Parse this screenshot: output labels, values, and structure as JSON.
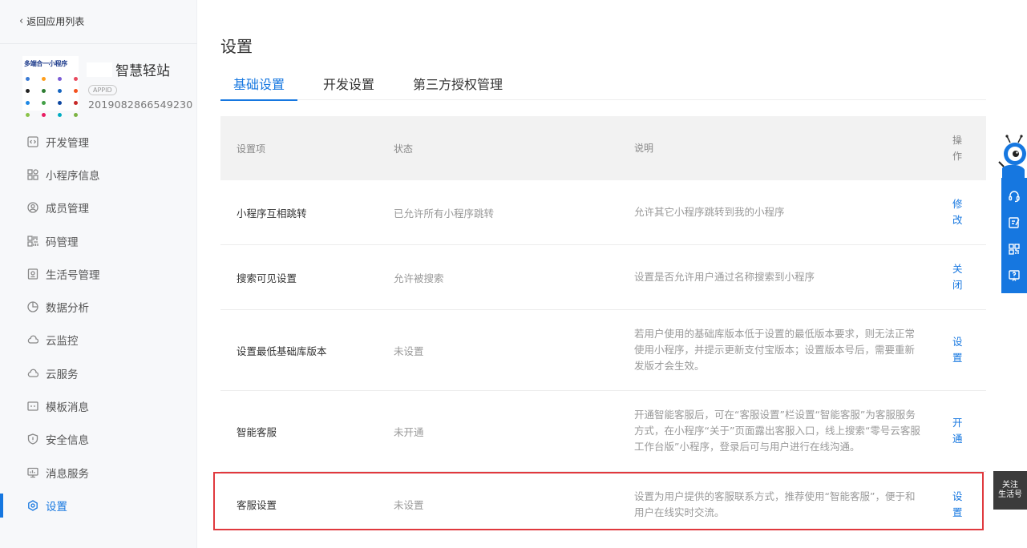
{
  "sidebar": {
    "back_label": "返回应用列表",
    "app": {
      "logo_text": "多端合一小程序",
      "name": "智慧轻站",
      "appid_badge": "APPID",
      "appid": "2019082866549230"
    },
    "items": [
      {
        "label": "开发管理",
        "icon": "code-icon"
      },
      {
        "label": "小程序信息",
        "icon": "grid-icon"
      },
      {
        "label": "成员管理",
        "icon": "user-icon"
      },
      {
        "label": "码管理",
        "icon": "qrcode-icon"
      },
      {
        "label": "生活号管理",
        "icon": "life-account-icon"
      },
      {
        "label": "数据分析",
        "icon": "pie-chart-icon"
      },
      {
        "label": "云监控",
        "icon": "cloud-icon"
      },
      {
        "label": "云服务",
        "icon": "cloud-icon"
      },
      {
        "label": "模板消息",
        "icon": "message-template-icon"
      },
      {
        "label": "安全信息",
        "icon": "shield-icon"
      },
      {
        "label": "消息服务",
        "icon": "monitor-icon"
      },
      {
        "label": "设置",
        "icon": "gear-icon",
        "active": true
      }
    ]
  },
  "main": {
    "title": "设置",
    "tabs": [
      {
        "label": "基础设置",
        "active": true
      },
      {
        "label": "开发设置"
      },
      {
        "label": "第三方授权管理"
      }
    ],
    "table": {
      "headers": [
        "设置项",
        "状态",
        "说明",
        "操作"
      ],
      "rows": [
        {
          "name": "小程序互相跳转",
          "status": "已允许所有小程序跳转",
          "desc": "允许其它小程序跳转到我的小程序",
          "action": "修改"
        },
        {
          "name": "搜索可见设置",
          "status": "允许被搜索",
          "desc": "设置是否允许用户通过名称搜索到小程序",
          "action": "关闭"
        },
        {
          "name": "设置最低基础库版本",
          "status": "未设置",
          "desc": "若用户使用的基础库版本低于设置的最低版本要求，则无法正常使用小程序，并提示更新支付宝版本；设置版本号后，需要重新发版才会生效。",
          "action": "设置"
        },
        {
          "name": "智能客服",
          "status": "未开通",
          "desc": "开通智能客服后，可在“客服设置”栏设置“智能客服”为客服服务方式，在小程序“关于”页面露出客服入口，线上搜索“零号云客服工作台版”小程序，登录后可与用户进行在线沟通。",
          "action": "开通"
        },
        {
          "name": "客服设置",
          "status": "未设置",
          "desc": "设置为用户提供的客服联系方式，推荐使用“智能客服”，便于和用户在线实时交流。",
          "action": "设置"
        }
      ]
    }
  },
  "float_bar": {
    "icons": [
      "headset-icon",
      "edit-icon",
      "qrcode-icon",
      "help-icon"
    ]
  },
  "follow_button": {
    "line1": "关注",
    "line2": "生活号"
  },
  "colors": {
    "accent": "#1677e0",
    "highlight": "#e0393e"
  }
}
